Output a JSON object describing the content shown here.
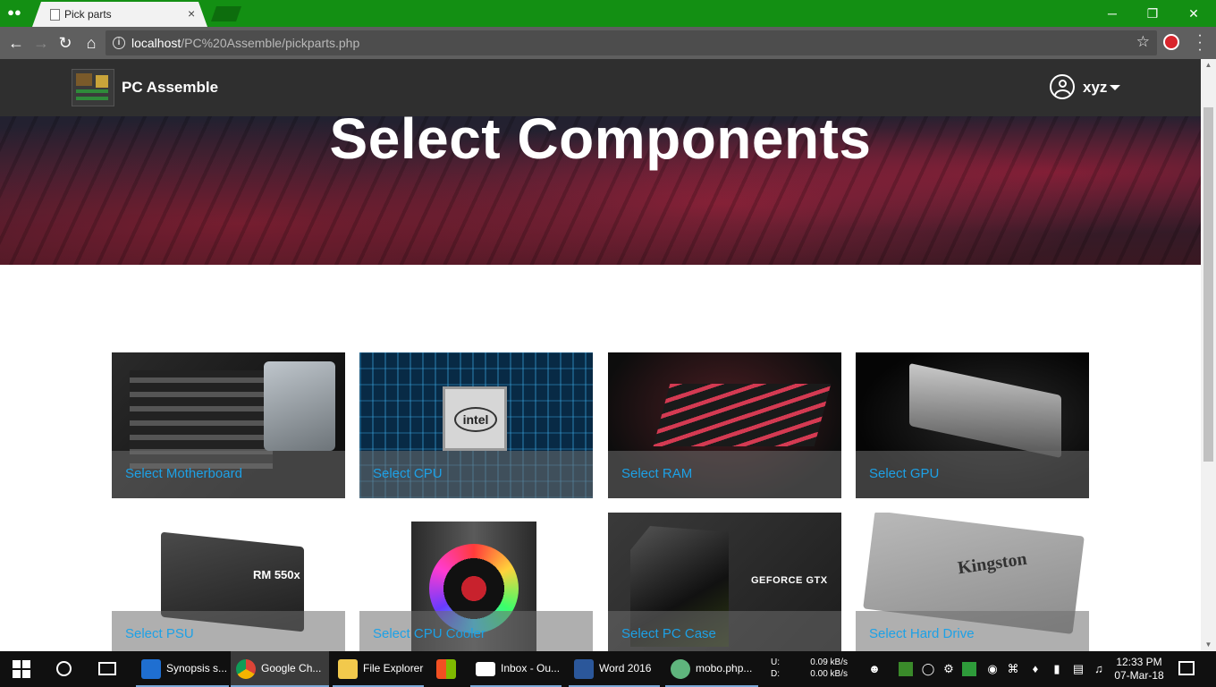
{
  "browser": {
    "tab_title": "Pick parts",
    "tab_close": "×",
    "url_host": "localhost",
    "url_path": "/PC%20Assemble/pickparts.php",
    "window_controls": [
      "─",
      "❐",
      "✕"
    ]
  },
  "site": {
    "brand": "PC Assemble",
    "username": "xyz",
    "hero_title": "Select Components"
  },
  "cards": [
    {
      "label": "Select Motherboard",
      "art": "motherboard"
    },
    {
      "label": "Select CPU",
      "art": "cpu",
      "badge": "intel"
    },
    {
      "label": "Select RAM",
      "art": "ram"
    },
    {
      "label": "Select GPU",
      "art": "gpu"
    },
    {
      "label": "Select PSU",
      "art": "psu",
      "badge": "RM 550x"
    },
    {
      "label": "Select CPU Cooler",
      "art": "cooler"
    },
    {
      "label": "Select PC Case",
      "art": "case",
      "badge": "GEFORCE GTX"
    },
    {
      "label": "Select Hard Drive",
      "art": "ssd",
      "badge": "Kingston"
    }
  ],
  "taskbar": {
    "apps": [
      {
        "label": "Synopsis s...",
        "icon": "edge-icon",
        "color": "#1f6fd1"
      },
      {
        "label": "Google Ch...",
        "icon": "chrome-icon",
        "color": "#e0b324",
        "active": true
      },
      {
        "label": "File Explorer",
        "icon": "folder-icon",
        "color": "#f2c94c"
      },
      {
        "label": "",
        "icon": "store-icon",
        "color": "#d9d9d9"
      },
      {
        "label": "Inbox - Ou...",
        "icon": "mail-icon",
        "color": "#ffffff"
      },
      {
        "label": "Word 2016",
        "icon": "word-icon",
        "color": "#2b579a"
      },
      {
        "label": "mobo.php...",
        "icon": "atom-icon",
        "color": "#5fb57d"
      }
    ],
    "net_up_label": "U:",
    "net_down_label": "D:",
    "net_up": "0.09 kB/s",
    "net_down": "0.00 kB/s",
    "time": "12:33 PM",
    "date": "07-Mar-18"
  }
}
